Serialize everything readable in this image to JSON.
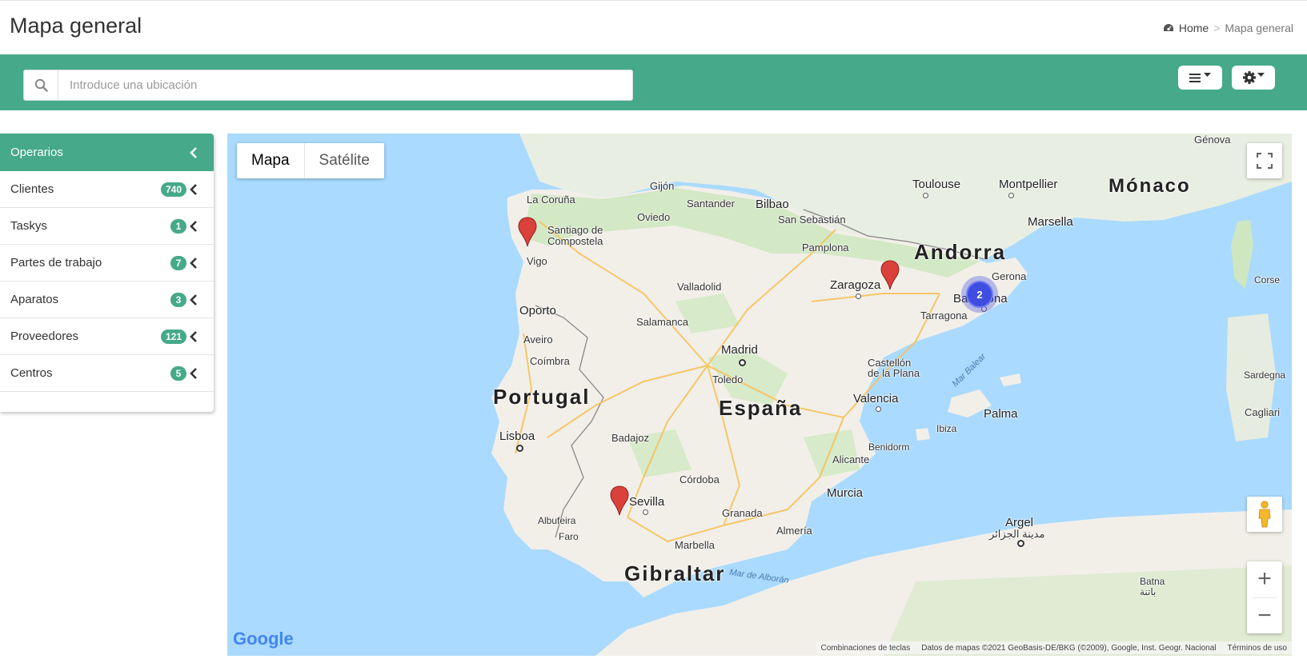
{
  "header": {
    "title": "Mapa general",
    "breadcrumb_home": "Home",
    "breadcrumb_sep": ">",
    "breadcrumb_current": "Mapa general"
  },
  "toolbar": {
    "search_placeholder": "Introduce una ubicación",
    "search_value": "",
    "list_menu_icon": "list-dropdown-icon",
    "settings_menu_icon": "gear-dropdown-icon"
  },
  "panel": {
    "title": "Operarios",
    "items": [
      {
        "label": "Clientes",
        "count": "740"
      },
      {
        "label": "Taskys",
        "count": "1"
      },
      {
        "label": "Partes de trabajo",
        "count": "7"
      },
      {
        "label": "Aparatos",
        "count": "3"
      },
      {
        "label": "Proveedores",
        "count": "121"
      },
      {
        "label": "Centros",
        "count": "5"
      }
    ]
  },
  "map": {
    "type_map": "Mapa",
    "type_satellite": "Satélite",
    "selected_type": "Mapa",
    "cluster_count": "2",
    "zoom_in": "+",
    "zoom_out": "−",
    "google_logo": "Google",
    "attribution": {
      "shortcuts": "Combinaciones de teclas",
      "data": "Datos de mapas ©2021 GeoBasis-DE/BKG (©2009), Google, Inst. Geogr. Nacional",
      "terms": "Términos de uso"
    },
    "labels": {
      "genova": "Génova",
      "toulouse": "Toulouse",
      "montpellier": "Montpellier",
      "monaco": "Mónaco",
      "marsella": "Marsella",
      "gijon": "Gijón",
      "coruna": "La Coruña",
      "santander": "Santander",
      "bilbao": "Bilbao",
      "oviedo": "Oviedo",
      "sansebastian": "San Sebastián",
      "santiago": "Santiago de",
      "compostela": "Compostela",
      "andorra": "Andorra",
      "pamplona": "Pamplona",
      "corse": "Corse",
      "gerona": "Gerona",
      "vigo": "Vigo",
      "zaragoza": "Zaragoza",
      "valladolid": "Valladolid",
      "barcelona": "Barcelona",
      "oporto": "Oporto",
      "tarragona": "Tarragona",
      "salamanca": "Salamanca",
      "aveiro": "Aveiro",
      "madrid": "Madrid",
      "coimbra": "Coímbra",
      "castellon": "Castellón",
      "delaplana": "de la Plana",
      "marbalear": "Mar Balear",
      "toledo": "Toledo",
      "sardegna": "Sardegna",
      "portugal": "Portugal",
      "espana": "España",
      "valencia": "Valencia",
      "palma": "Palma",
      "cagliari": "Cagliari",
      "lisboa": "Lisboa",
      "badajoz": "Badajoz",
      "ibiza": "Ibiza",
      "benidorm": "Benidorm",
      "alicante": "Alicante",
      "cordoba": "Córdoba",
      "murcia": "Murcia",
      "sevilla": "Sevilla",
      "granada": "Granada",
      "argel": "Argel",
      "argel_ar": "مدينة الجزائر",
      "albufeira": "Albufeira",
      "almeria": "Almería",
      "faro": "Faro",
      "marbella": "Marbella",
      "gibraltar": "Gibraltar",
      "maralboran": "Mar de Alborán",
      "batna": "Batna",
      "batna_ar": "باتنة"
    }
  },
  "colors": {
    "accent": "#45a98a",
    "marker": "#d9413a",
    "cluster": "#3f4ee0",
    "water": "#aadaff",
    "land": "#f2efe9",
    "green_land": "#cfe7c0"
  }
}
